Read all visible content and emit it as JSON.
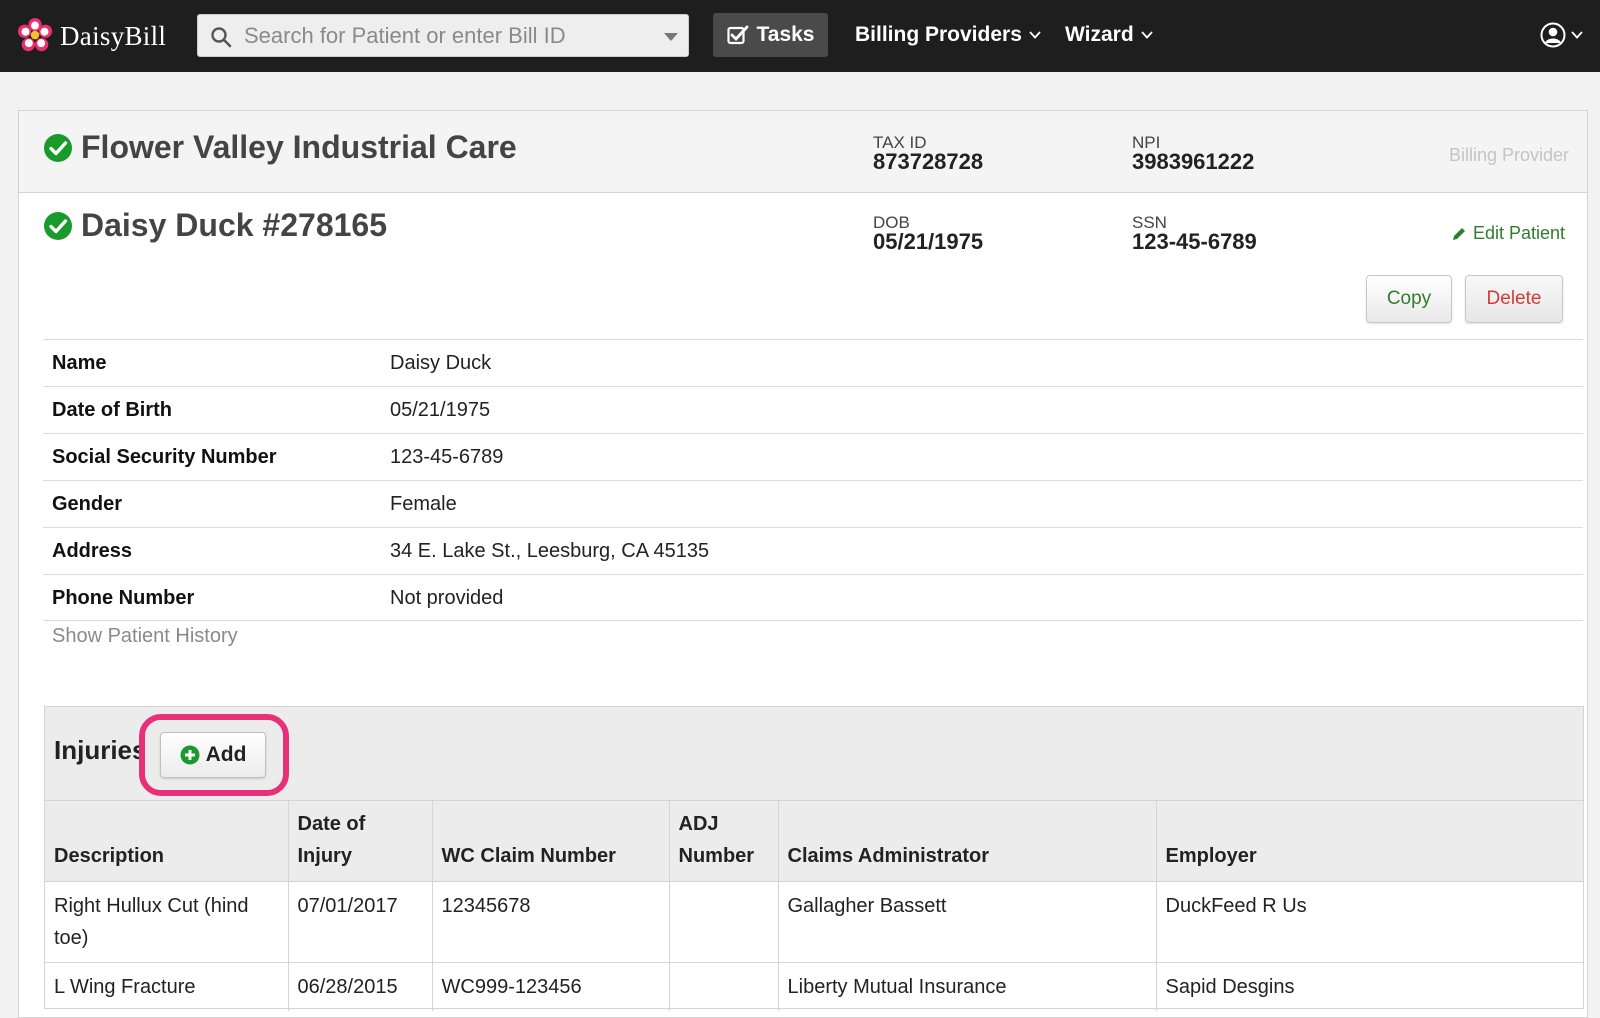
{
  "nav": {
    "brand": "DaisyBill",
    "search_placeholder": "Search for Patient or enter Bill ID",
    "tasks_label": "Tasks",
    "billing_providers_label": "Billing Providers",
    "wizard_label": "Wizard"
  },
  "provider": {
    "name": "Flower Valley Industrial Care",
    "tax_id_label": "TAX ID",
    "tax_id": "873728728",
    "npi_label": "NPI",
    "npi": "3983961222",
    "tag": "Billing Provider"
  },
  "patient": {
    "title": "Daisy Duck #278165",
    "dob_label": "DOB",
    "dob": "05/21/1975",
    "ssn_label": "SSN",
    "ssn": "123-45-6789",
    "edit_label": "Edit Patient",
    "copy_label": "Copy",
    "delete_label": "Delete"
  },
  "details": [
    {
      "label": "Name",
      "value": "Daisy Duck"
    },
    {
      "label": "Date of Birth",
      "value": "05/21/1975"
    },
    {
      "label": "Social Security Number",
      "value": "123-45-6789"
    },
    {
      "label": "Gender",
      "value": "Female"
    },
    {
      "label": "Address",
      "value": "34 E. Lake St., Leesburg, CA 45135"
    },
    {
      "label": "Phone Number",
      "value": "Not provided"
    }
  ],
  "history_link": "Show Patient History",
  "injuries": {
    "title": "Injuries",
    "add_label": "Add",
    "columns": {
      "description": "Description",
      "date_of_injury": "Date of Injury",
      "wc_claim_number": "WC Claim Number",
      "adj_number": "ADJ Number",
      "claims_administrator": "Claims Administrator",
      "employer": "Employer"
    },
    "rows": [
      {
        "description": "Right Hullux Cut (hind toe)",
        "date": "07/01/2017",
        "wc_claim": "12345678",
        "adj": "",
        "administrator": "Gallagher Bassett",
        "employer": "DuckFeed R Us"
      },
      {
        "description": "L Wing Fracture",
        "date": "06/28/2015",
        "wc_claim": "WC999-123456",
        "adj": "",
        "administrator": "Liberty Mutual Insurance",
        "employer": "Sapid Desgins"
      }
    ]
  },
  "colors": {
    "navbar": "#1e1e1e",
    "success_green": "#1a9a2a",
    "highlight_pink": "#e8307a",
    "delete_red": "#d43a3a"
  }
}
